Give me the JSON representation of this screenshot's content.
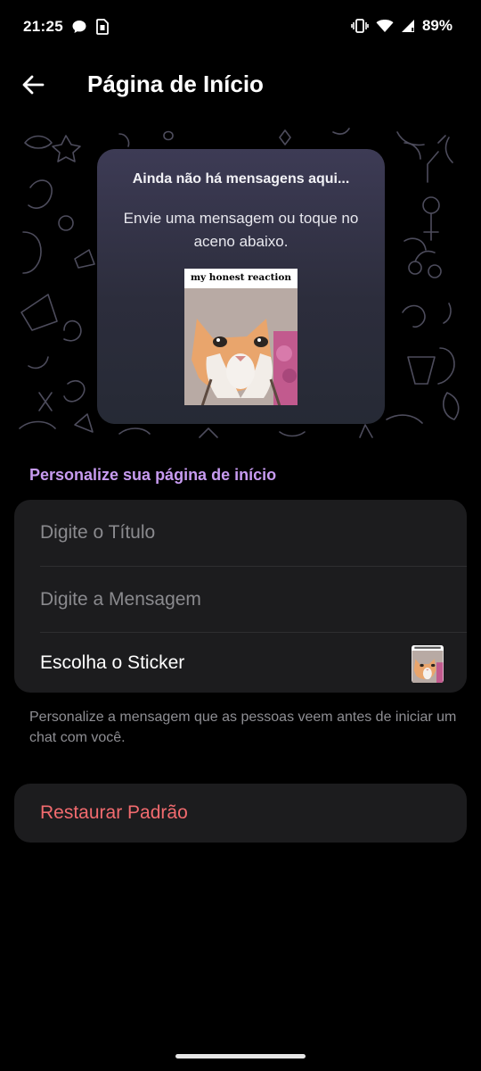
{
  "status_bar": {
    "time": "21:25",
    "left_icons": [
      "chat-bubble-icon",
      "sim-card-icon"
    ],
    "right_icons": [
      "vibrate-icon",
      "wifi-icon",
      "cell-signal-icon"
    ],
    "battery": "89%"
  },
  "app_bar": {
    "back_icon": "arrow-left-icon",
    "title": "Página de Início"
  },
  "preview": {
    "card_title": "Ainda não há mensagens aqui...",
    "card_message": "Envie uma mensagem ou toque no aceno abaixo.",
    "sticker_caption": "my honest reaction"
  },
  "customize": {
    "section_label": "Personalize sua página de início",
    "title_placeholder": "Digite o Título",
    "message_placeholder": "Digite a Mensagem",
    "sticker_label": "Escolha o Sticker",
    "sticker_thumb_caption": "my honest reaction",
    "helper_text": "Personalize a mensagem que as pessoas veem antes de iniciar um chat com você."
  },
  "restore": {
    "label": "Restaurar Padrão"
  },
  "colors": {
    "background": "#000000",
    "card": "#1c1c1e",
    "accent_purple": "#c79bf0",
    "destructive_red": "#f26b6f",
    "placeholder_gray": "#8a8a8e"
  }
}
